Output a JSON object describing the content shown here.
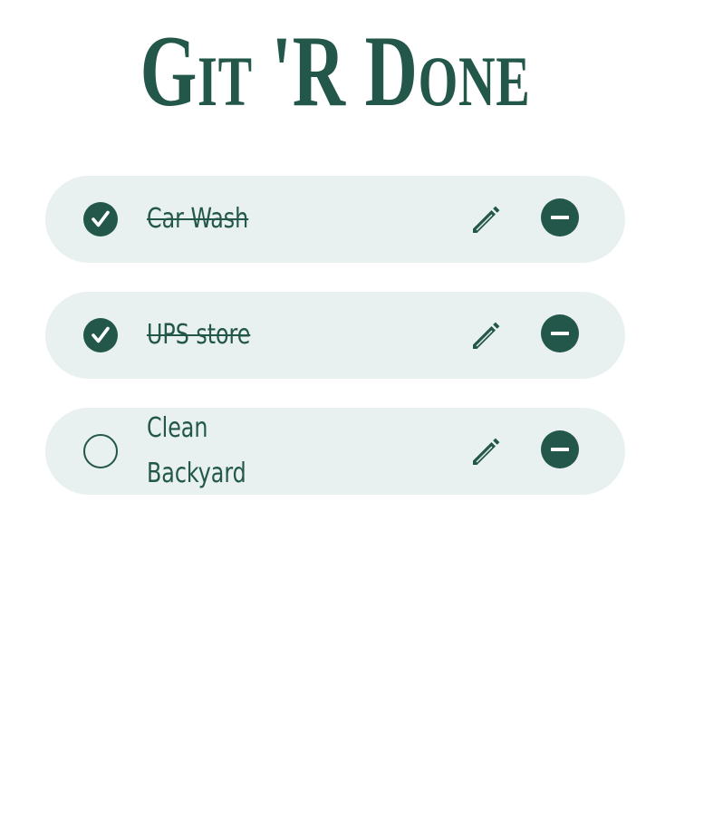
{
  "app": {
    "title": "Git 'R Done"
  },
  "tasks": [
    {
      "label": "Car Wash",
      "completed": true,
      "edit_icon": "pencil-icon",
      "delete_icon": "minus-circle-icon"
    },
    {
      "label": "UPS store",
      "completed": true,
      "edit_icon": "pencil-icon",
      "delete_icon": "minus-circle-icon"
    },
    {
      "label": "Clean Backyard",
      "completed": false,
      "edit_icon": "pencil-icon",
      "delete_icon": "minus-circle-icon"
    }
  ],
  "colors": {
    "primary": "#22574a",
    "item_background": "#e8f1ef",
    "page_background": "#ffffff"
  }
}
